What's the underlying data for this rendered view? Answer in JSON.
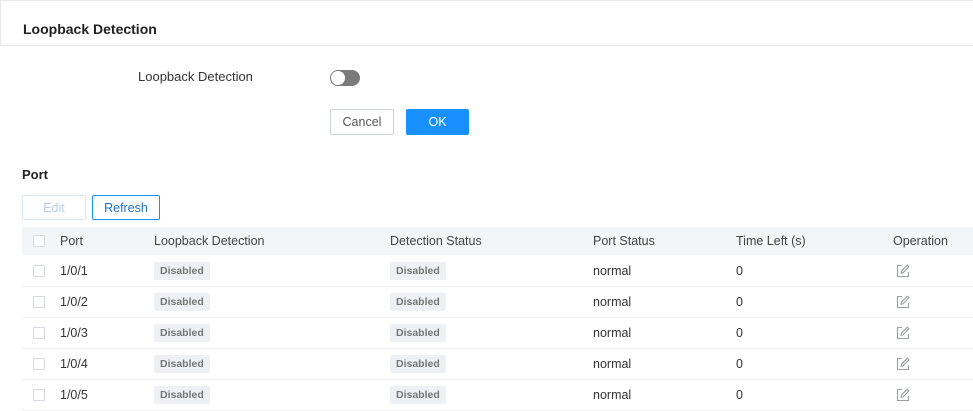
{
  "header": {
    "title": "Loopback Detection"
  },
  "form": {
    "label": "Loopback Detection",
    "toggle_state": "off",
    "cancel_label": "Cancel",
    "ok_label": "OK"
  },
  "section": {
    "title": "Port",
    "edit_label": "Edit",
    "refresh_label": "Refresh"
  },
  "table": {
    "columns": [
      "Port",
      "Loopback Detection",
      "Detection Status",
      "Port Status",
      "Time Left (s)",
      "Operation"
    ],
    "rows": [
      {
        "port": "1/0/1",
        "loopback": "Disabled",
        "detection_status": "Disabled",
        "port_status": "normal",
        "time_left": "0"
      },
      {
        "port": "1/0/2",
        "loopback": "Disabled",
        "detection_status": "Disabled",
        "port_status": "normal",
        "time_left": "0"
      },
      {
        "port": "1/0/3",
        "loopback": "Disabled",
        "detection_status": "Disabled",
        "port_status": "normal",
        "time_left": "0"
      },
      {
        "port": "1/0/4",
        "loopback": "Disabled",
        "detection_status": "Disabled",
        "port_status": "normal",
        "time_left": "0"
      },
      {
        "port": "1/0/5",
        "loopback": "Disabled",
        "detection_status": "Disabled",
        "port_status": "normal",
        "time_left": "0"
      }
    ]
  },
  "icons": {
    "operation": "edit-icon"
  },
  "colors": {
    "accent": "#1890ff",
    "toggle_off": "#7a7a7a",
    "tag_bg": "#eef0f3"
  }
}
